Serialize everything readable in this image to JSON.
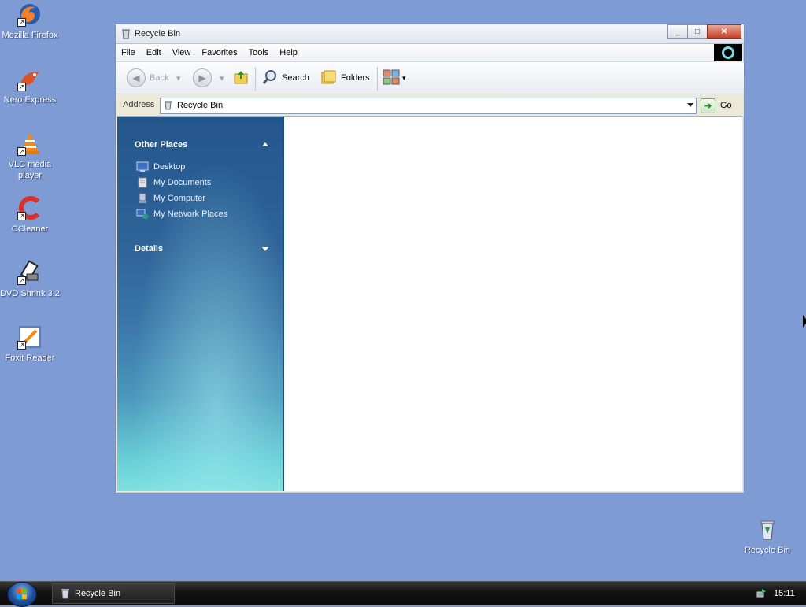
{
  "desktop": {
    "icons": [
      {
        "label": "Mozilla Firefox"
      },
      {
        "label": "Nero Express"
      },
      {
        "label": "VLC media player"
      },
      {
        "label": "CCleaner"
      },
      {
        "label": "DVD Shrink 3.2"
      },
      {
        "label": "Foxit Reader"
      }
    ],
    "recycle_bin_label": "Recycle Bin"
  },
  "window": {
    "title": "Recycle Bin",
    "controls": {
      "minimize": "_",
      "maximize": "□",
      "close": "✕"
    },
    "menu": [
      "File",
      "Edit",
      "View",
      "Favorites",
      "Tools",
      "Help"
    ],
    "toolbar": {
      "back_label": "Back",
      "search_label": "Search",
      "folders_label": "Folders"
    },
    "address": {
      "label": "Address",
      "value": "Recycle Bin",
      "go_label": "Go"
    },
    "task_pane": {
      "other_places_header": "Other Places",
      "links": [
        "Desktop",
        "My Documents",
        "My Computer",
        "My Network Places"
      ],
      "details_header": "Details"
    }
  },
  "taskbar": {
    "active_window_label": "Recycle Bin",
    "clock": "15:11"
  }
}
